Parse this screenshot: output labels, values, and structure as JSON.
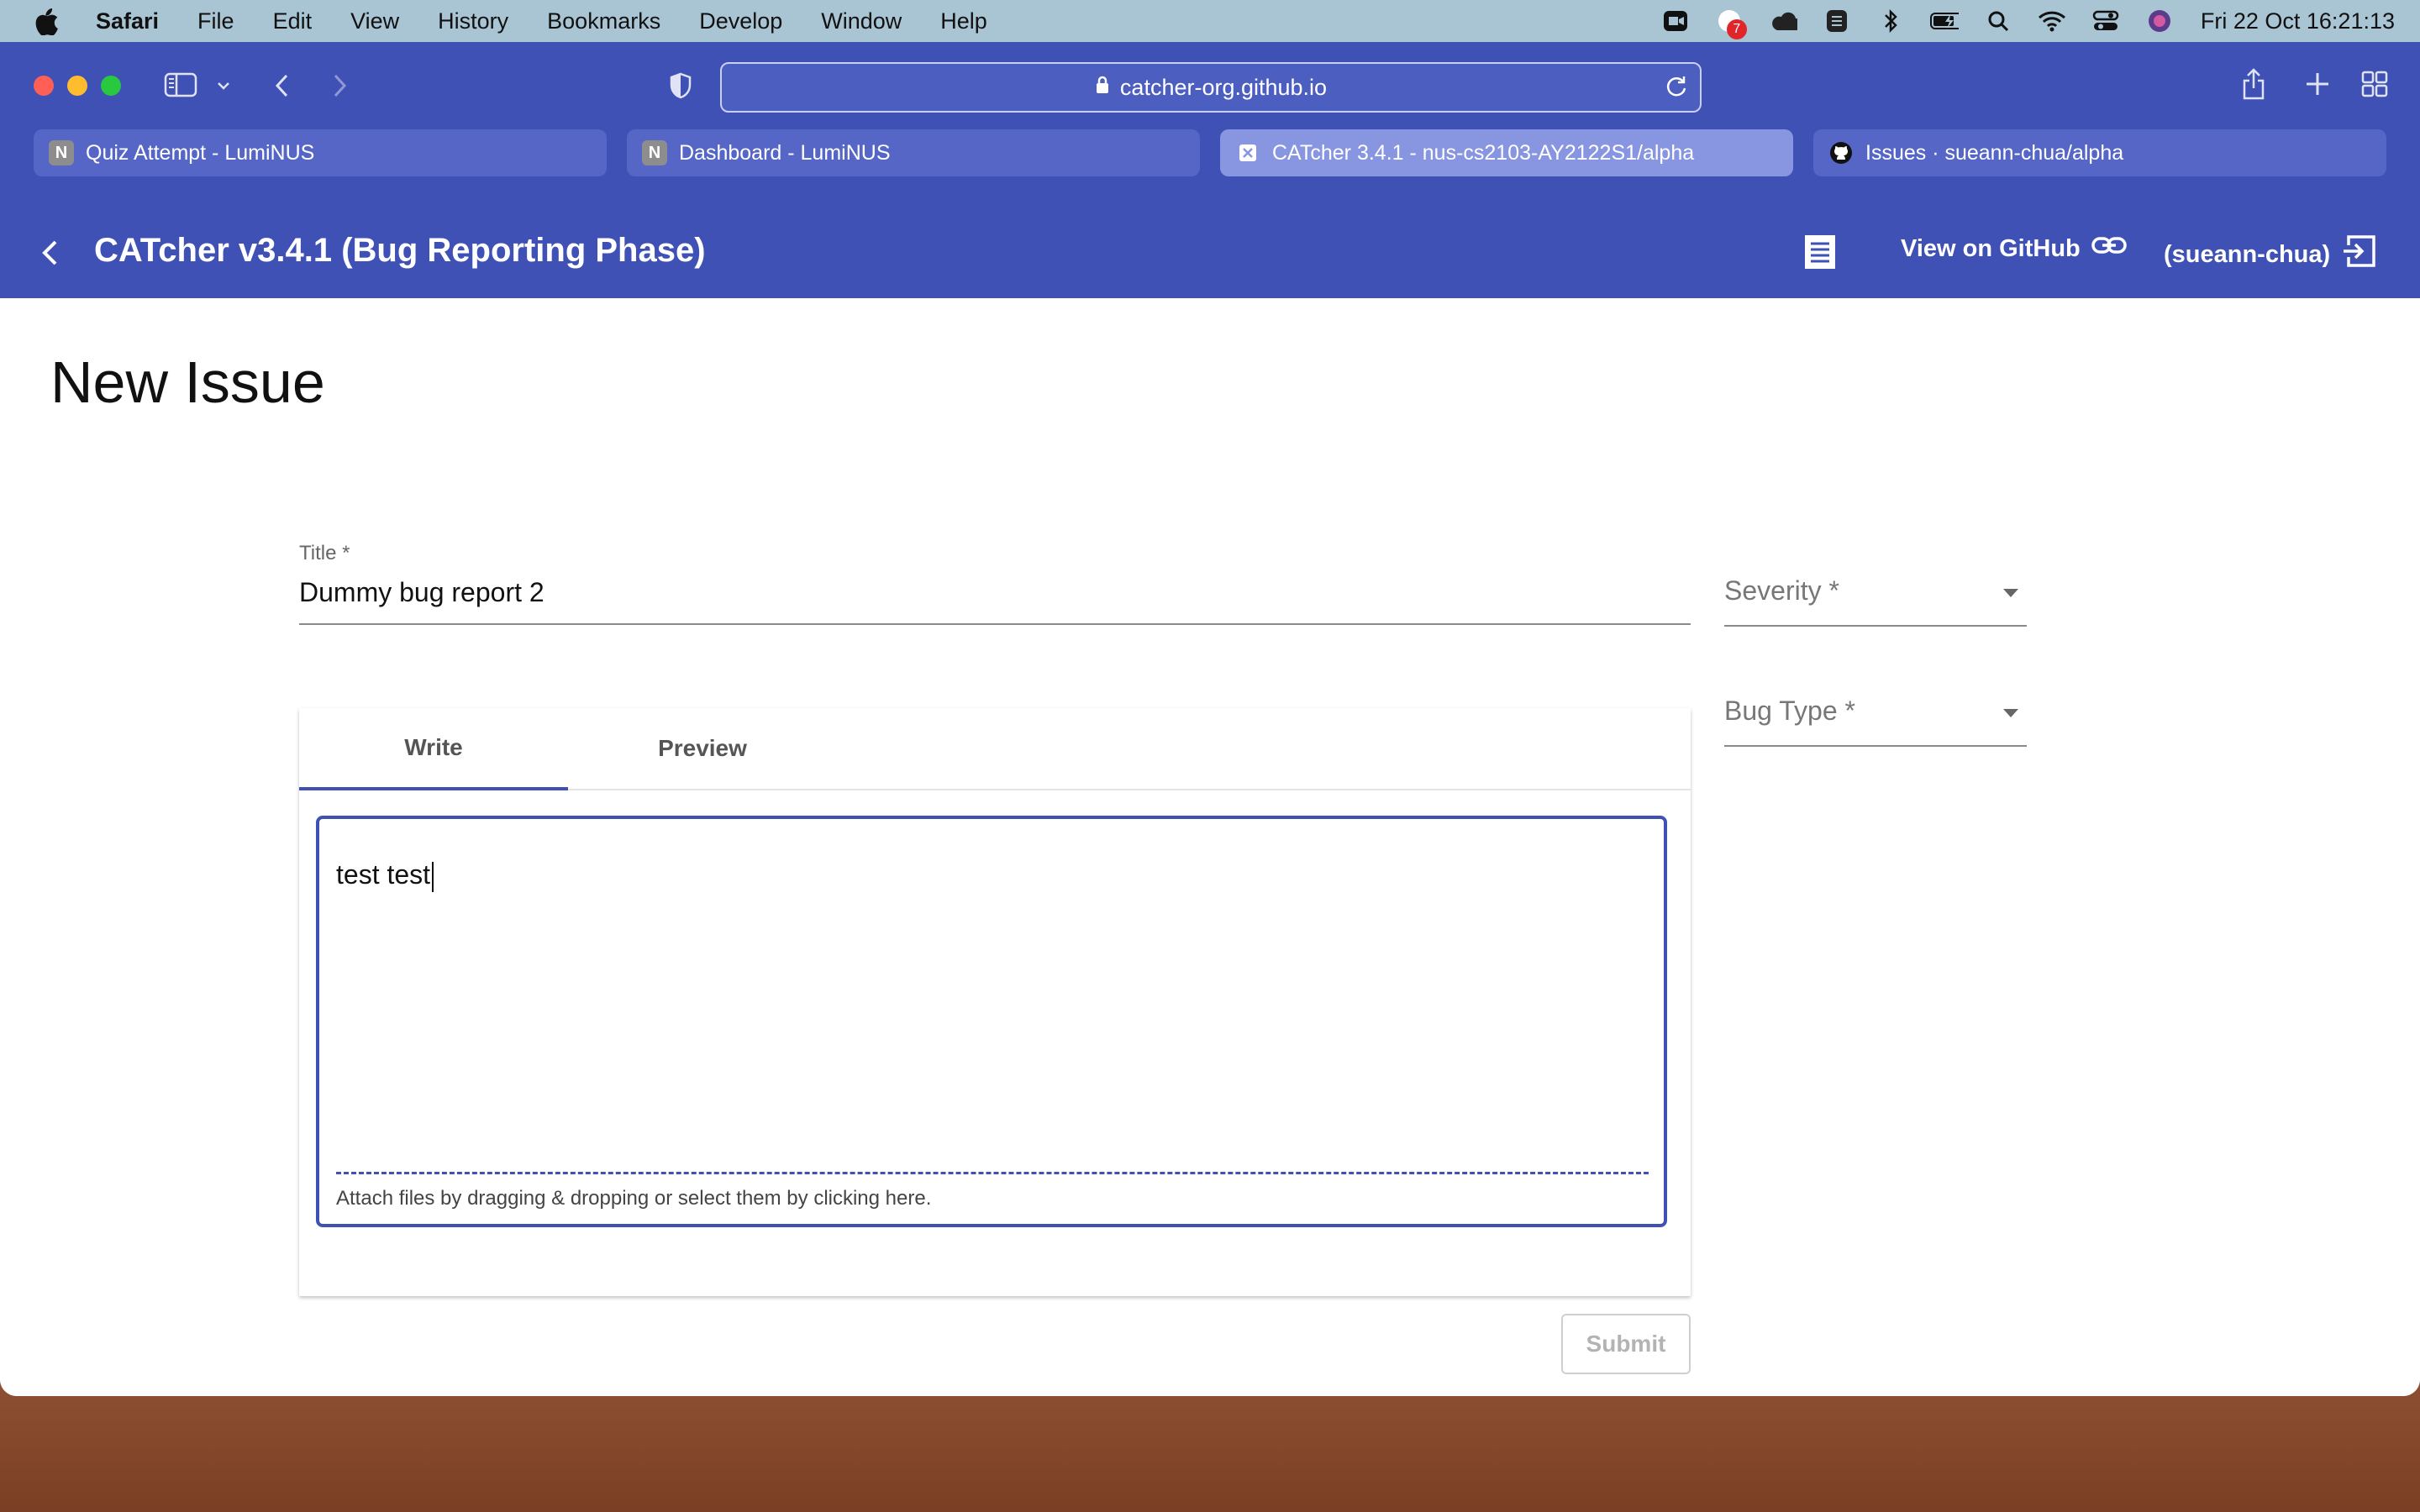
{
  "menubar": {
    "app": "Safari",
    "items": [
      "File",
      "Edit",
      "View",
      "History",
      "Bookmarks",
      "Develop",
      "Window",
      "Help"
    ],
    "notification_count": "7",
    "clock": "Fri 22 Oct  16:21:13"
  },
  "browser": {
    "url": "catcher-org.github.io",
    "tabs": [
      {
        "label": "Quiz Attempt - LumiNUS",
        "favicon": "N"
      },
      {
        "label": "Dashboard - LumiNUS",
        "favicon": "N"
      },
      {
        "label": "CATcher 3.4.1 - nus-cs2103-AY2122S1/alpha",
        "favicon": "X"
      },
      {
        "label": "Issues · sueann-chua/alpha",
        "favicon": "github"
      }
    ]
  },
  "appbar": {
    "title": "CATcher v3.4.1  (Bug Reporting Phase)",
    "github_link": "View on GitHub",
    "user": "(sueann-chua)"
  },
  "form": {
    "page_title": "New Issue",
    "title_label": "Title *",
    "title_value": "Dummy bug report 2",
    "severity_placeholder": "Severity *",
    "bugtype_placeholder": "Bug Type *",
    "tabs": [
      "Write",
      "Preview"
    ],
    "description_value": "test test",
    "attach_hint": "Attach files by dragging & dropping or select them by clicking here.",
    "submit_label": "Submit"
  },
  "colors": {
    "primary": "#3f51b5",
    "menubar": "#a9c4d3"
  }
}
